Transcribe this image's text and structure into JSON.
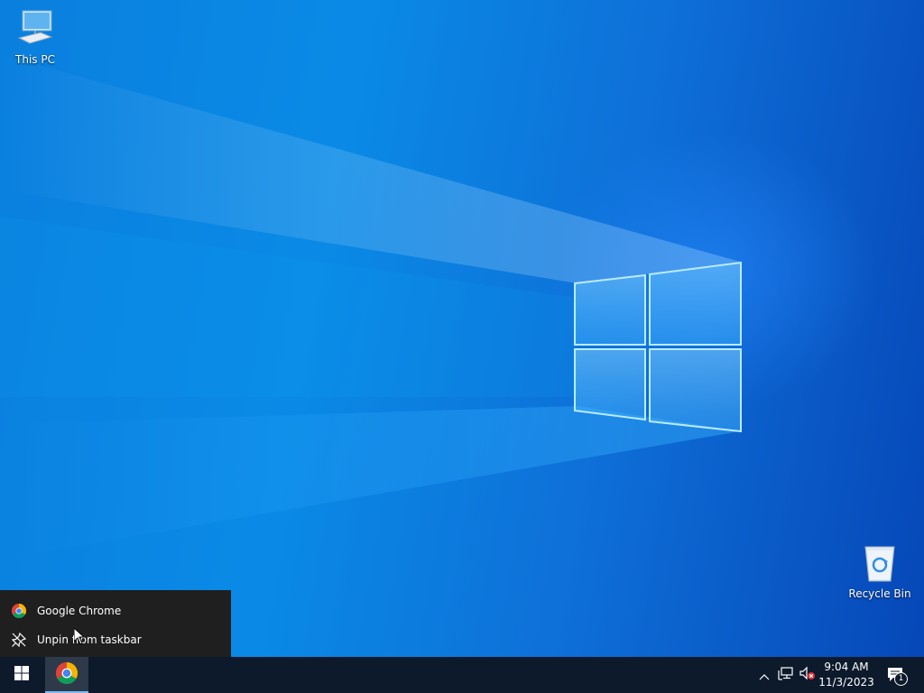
{
  "desktop": {
    "icons": [
      {
        "label": "This PC",
        "icon": "computer-icon"
      },
      {
        "label": "Recycle Bin",
        "icon": "recycle-bin-icon"
      }
    ]
  },
  "jumplist": {
    "items": [
      {
        "label": "Google Chrome",
        "icon": "chrome-icon"
      },
      {
        "label": "Unpin from taskbar",
        "icon": "unpin-icon"
      }
    ]
  },
  "taskbar": {
    "start_icon": "windows-logo-icon",
    "pinned_app_icon": "chrome-icon",
    "tray": {
      "overflow_icon": "chevron-up-icon",
      "network_icon": "network-icon",
      "volume_icon": "volume-muted-icon",
      "notification_icon": "action-center-icon",
      "notification_count": "1"
    },
    "clock": {
      "time": "9:04 AM",
      "date": "11/3/2023"
    }
  },
  "colors": {
    "taskbar_bg": "#0c1a2c",
    "jumplist_bg": "#1f1f1f",
    "wallpaper_blue": "#0a8ae6"
  }
}
